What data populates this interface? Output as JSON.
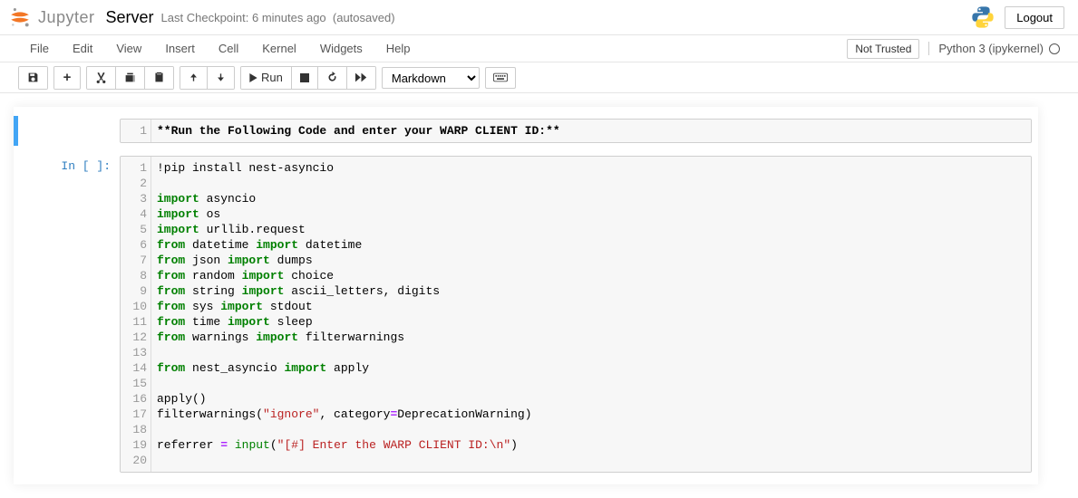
{
  "header": {
    "jupyter_word": "Jupyter",
    "notebook_name": "Server",
    "checkpoint": "Last Checkpoint: 6 minutes ago",
    "autosave": "(autosaved)",
    "logout": "Logout"
  },
  "menubar": {
    "items": [
      "File",
      "Edit",
      "View",
      "Insert",
      "Cell",
      "Kernel",
      "Widgets",
      "Help"
    ],
    "trust": "Not Trusted",
    "kernel_name": "Python 3 (ipykernel)"
  },
  "toolbar": {
    "run_label": "Run",
    "cell_type": "Markdown"
  },
  "cells": {
    "markdown": {
      "line_no": "1",
      "text": "**Run the Following Code and enter your WARP CLIENT ID:**"
    },
    "code": {
      "prompt": "In [ ]:",
      "lines": [
        {
          "n": "1",
          "t": [
            "!pip install nest-asyncio"
          ],
          "cls": [
            "cm-magic"
          ]
        },
        {
          "n": "2",
          "t": [
            ""
          ],
          "cls": []
        },
        {
          "n": "3",
          "t": [
            "import",
            " asyncio"
          ],
          "cls": [
            "cm-keyword",
            ""
          ]
        },
        {
          "n": "4",
          "t": [
            "import",
            " os"
          ],
          "cls": [
            "cm-keyword",
            ""
          ]
        },
        {
          "n": "5",
          "t": [
            "import",
            " urllib.request"
          ],
          "cls": [
            "cm-keyword",
            ""
          ]
        },
        {
          "n": "6",
          "t": [
            "from",
            " datetime ",
            "import",
            " datetime"
          ],
          "cls": [
            "cm-keyword",
            "",
            "cm-keyword",
            ""
          ]
        },
        {
          "n": "7",
          "t": [
            "from",
            " json ",
            "import",
            " dumps"
          ],
          "cls": [
            "cm-keyword",
            "",
            "cm-keyword",
            ""
          ]
        },
        {
          "n": "8",
          "t": [
            "from",
            " random ",
            "import",
            " choice"
          ],
          "cls": [
            "cm-keyword",
            "",
            "cm-keyword",
            ""
          ]
        },
        {
          "n": "9",
          "t": [
            "from",
            " string ",
            "import",
            " ascii_letters, digits"
          ],
          "cls": [
            "cm-keyword",
            "",
            "cm-keyword",
            ""
          ]
        },
        {
          "n": "10",
          "t": [
            "from",
            " sys ",
            "import",
            " stdout"
          ],
          "cls": [
            "cm-keyword",
            "",
            "cm-keyword",
            ""
          ]
        },
        {
          "n": "11",
          "t": [
            "from",
            " time ",
            "import",
            " sleep"
          ],
          "cls": [
            "cm-keyword",
            "",
            "cm-keyword",
            ""
          ]
        },
        {
          "n": "12",
          "t": [
            "from",
            " warnings ",
            "import",
            " filterwarnings"
          ],
          "cls": [
            "cm-keyword",
            "",
            "cm-keyword",
            ""
          ]
        },
        {
          "n": "13",
          "t": [
            ""
          ],
          "cls": []
        },
        {
          "n": "14",
          "t": [
            "from",
            " nest_asyncio ",
            "import",
            " apply"
          ],
          "cls": [
            "cm-keyword",
            "",
            "cm-keyword",
            ""
          ]
        },
        {
          "n": "15",
          "t": [
            ""
          ],
          "cls": []
        },
        {
          "n": "16",
          "t": [
            "apply()"
          ],
          "cls": [
            ""
          ]
        },
        {
          "n": "17",
          "t": [
            "filterwarnings(",
            "\"ignore\"",
            ", category",
            "=",
            "DeprecationWarning)"
          ],
          "cls": [
            "",
            "cm-string",
            "",
            "cm-operator",
            ""
          ]
        },
        {
          "n": "18",
          "t": [
            ""
          ],
          "cls": []
        },
        {
          "n": "19",
          "t": [
            "referrer ",
            "=",
            " ",
            "input",
            "(",
            "\"[#] Enter the WARP CLIENT ID:\\n\"",
            ")"
          ],
          "cls": [
            "",
            "cm-operator",
            "",
            "cm-builtin",
            "",
            "cm-string",
            ""
          ]
        },
        {
          "n": "20",
          "t": [
            ""
          ],
          "cls": []
        }
      ]
    }
  }
}
